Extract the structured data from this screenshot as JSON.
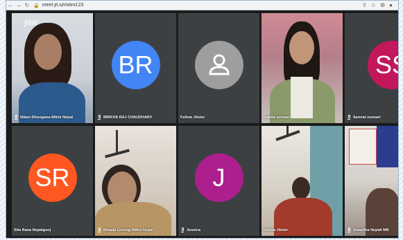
{
  "browser": {
    "url": "meet.jit.si/mitini123",
    "nav_back": "←",
    "nav_forward": "→",
    "nav_reload": "↻",
    "icons": [
      "share-icon",
      "star-icon",
      "extensions-icon",
      "profile-icon"
    ]
  },
  "participants": [
    {
      "name": "Nilam Dhungana-Mitini Nepal",
      "type": "video",
      "watermark": "jitsi"
    },
    {
      "name": "BIRKHA RAJ CHAUDHARY",
      "type": "avatar",
      "initials": "BR",
      "color": "#4285f4"
    },
    {
      "name": "Fellow Jitster",
      "type": "avatar-icon",
      "color": "#9e9e9e"
    },
    {
      "name": "Kabita sunsari",
      "type": "video",
      "active": true
    },
    {
      "name": "Samrat sunsari",
      "type": "avatar",
      "initials": "SS",
      "color": "#c2185b"
    },
    {
      "name": "Sita Rana Nepalgunj",
      "type": "avatar",
      "initials": "SR",
      "color": "#ff5722"
    },
    {
      "name": "Bimala Gurung Mitini Nepal",
      "type": "video"
    },
    {
      "name": "Jessica",
      "type": "avatar",
      "initials": "J",
      "color": "#ad1f8d"
    },
    {
      "name": "Fellow Jitster",
      "type": "video"
    },
    {
      "name": "Swastika Nepali MN",
      "type": "video"
    }
  ]
}
